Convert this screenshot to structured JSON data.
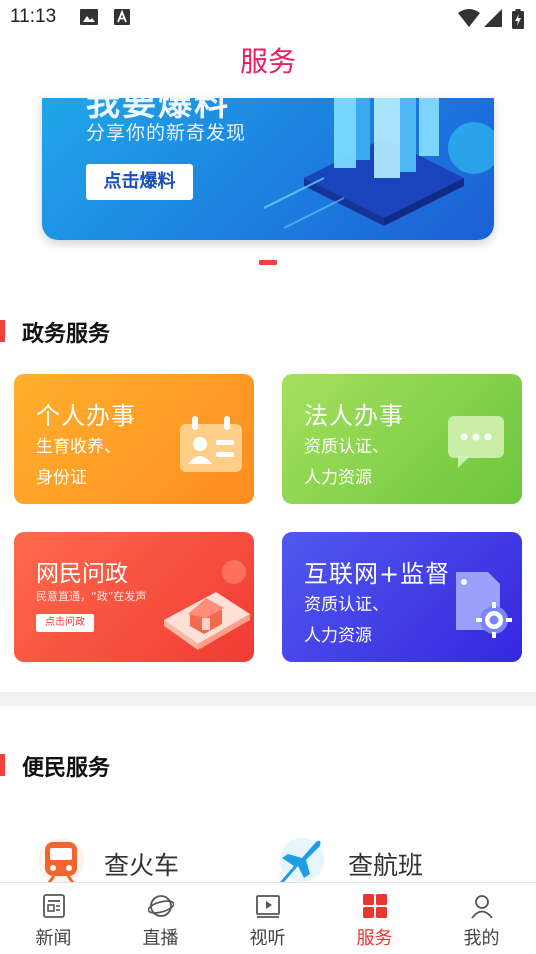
{
  "status_bar": {
    "time": "11:13",
    "icons": [
      "image-icon",
      "a-icon",
      "wifi-icon",
      "signal-icon",
      "battery-icon"
    ]
  },
  "header": {
    "title": "服务"
  },
  "banner": {
    "headline": "我要爆料",
    "subtitle": "分享你的新奇发现",
    "button_label": "点击爆料",
    "active_slide": 1
  },
  "gov_section": {
    "title": "政务服务",
    "cards": [
      {
        "title": "个人办事",
        "desc": "生育收养、\n身份证",
        "icon": "id-card-icon",
        "color": "#ff9f26"
      },
      {
        "title": "法人办事",
        "desc": "资质认证、\n人力资源",
        "icon": "chat-bubble-icon",
        "color": "#8fd64d"
      },
      {
        "title": "网民问政",
        "subtitle": "民意直通，“政”在发声",
        "button_label": "点击问政",
        "icon": "phone-house-icon",
        "color": "#f4503b"
      },
      {
        "title": "互联网+监督",
        "desc": "资质认证、\n人力资源",
        "icon": "document-gear-icon",
        "color": "#4540e8"
      }
    ]
  },
  "convenience_section": {
    "title": "便民服务",
    "items": [
      {
        "label": "查火车",
        "icon": "train-icon"
      },
      {
        "label": "查航班",
        "icon": "airplane-icon"
      }
    ]
  },
  "bottom_nav": {
    "items": [
      {
        "label": "新闻",
        "icon": "news-icon"
      },
      {
        "label": "直播",
        "icon": "live-icon"
      },
      {
        "label": "视听",
        "icon": "video-icon"
      },
      {
        "label": "服务",
        "icon": "service-grid-icon",
        "active": true
      },
      {
        "label": "我的",
        "icon": "profile-icon"
      }
    ]
  },
  "colors": {
    "accent": "#e8205f",
    "nav_active": "#e8372f",
    "section_bar": "#f0413c"
  }
}
